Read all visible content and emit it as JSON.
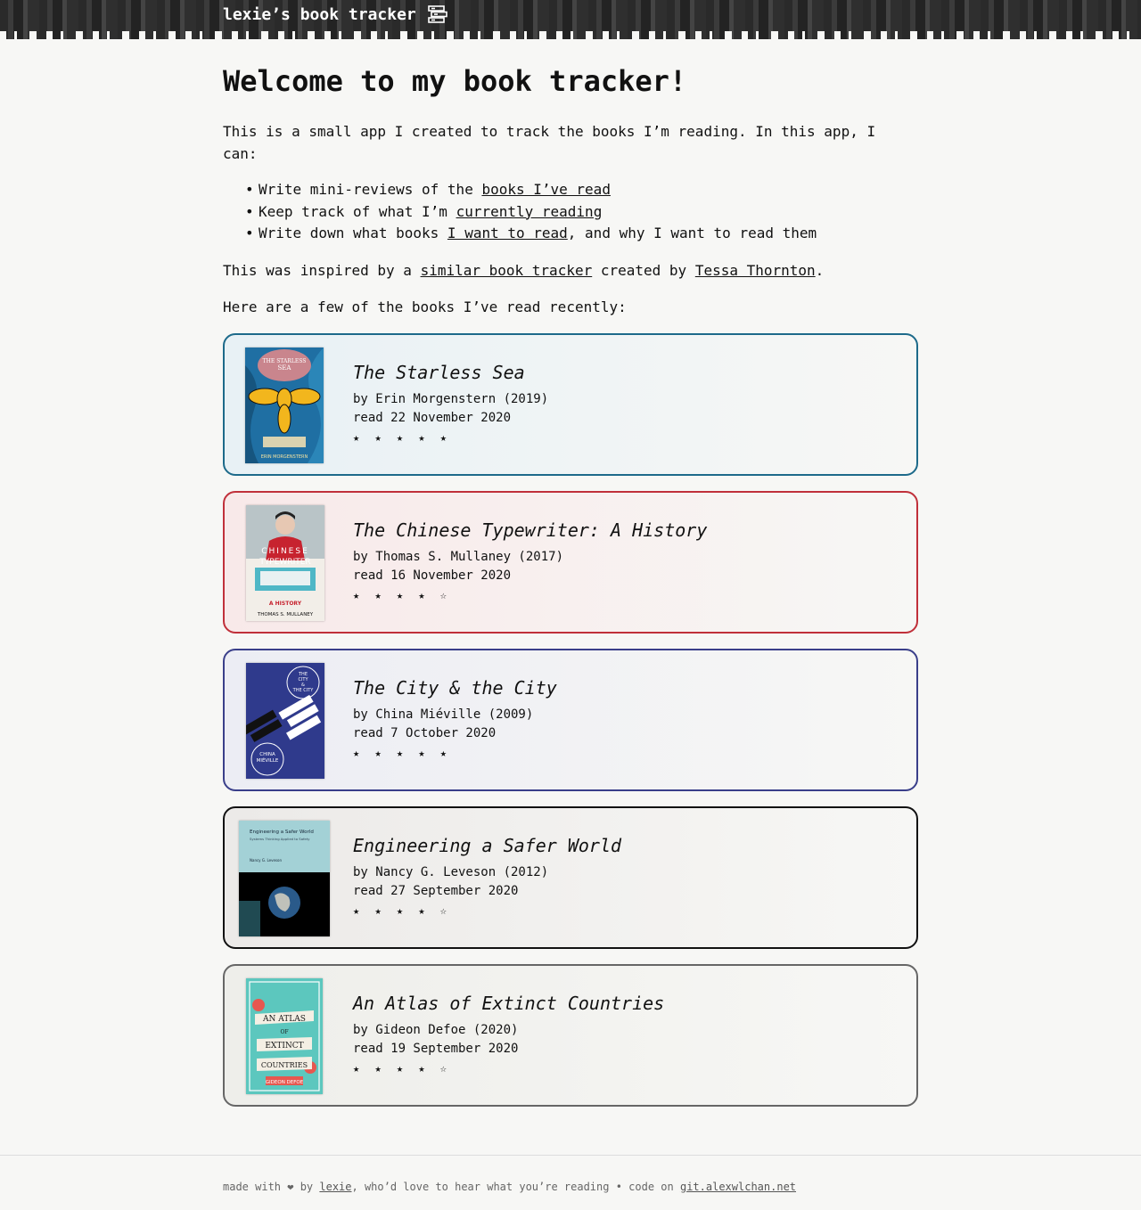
{
  "header": {
    "site_title": "lexie’s book tracker",
    "icon": "books-icon"
  },
  "main": {
    "heading": "Welcome to my book tracker!",
    "intro": "This is a small app I created to track the books I’m reading. In this app, I can:",
    "features": [
      {
        "before": "Write mini-reviews of the ",
        "link": "books I’ve read",
        "after": ""
      },
      {
        "before": "Keep track of what I’m ",
        "link": "currently reading",
        "after": ""
      },
      {
        "before": "Write down what books ",
        "link": "I want to read",
        "after": ", and why I want to read them"
      }
    ],
    "inspired": {
      "before": "This was inspired by a ",
      "link1": "similar book tracker",
      "middle": " created by ",
      "link2": "Tessa Thornton",
      "after": "."
    },
    "recent_intro": "Here are a few of the books I’ve read recently:"
  },
  "books": [
    {
      "title": "The Starless Sea",
      "author_line": "by Erin Morgenstern (2019)",
      "read_line": "read 22 November 2020",
      "rating": "★ ★ ★ ★ ★",
      "border_color": "#1d6a8a",
      "tint": "#e8f1f5",
      "cover": {
        "text_top": "THE STARLESS SEA",
        "text_bottom": "ERIN MORGENSTERN",
        "bg": "#1e6ea0"
      }
    },
    {
      "title": "The Chinese Typewriter: A History",
      "author_line": "by Thomas S. Mullaney (2017)",
      "read_line": "read 16 November 2020",
      "rating": "★ ★ ★ ★ ☆",
      "border_color": "#c0303a",
      "tint": "#f8e9e9",
      "cover": {
        "text_top": "THE CHINESE TYPEWRITER",
        "text_bottom": "A HISTORY",
        "author": "THOMAS S. MULLANEY",
        "bg": "#f0ece6"
      }
    },
    {
      "title": "The City & the City",
      "author_line": "by China Miéville (2009)",
      "read_line": "read 7 October 2020",
      "rating": "★ ★ ★ ★ ★",
      "border_color": "#3a3f8a",
      "tint": "#ecedf4",
      "cover": {
        "text_top": "THE CITY & THE CITY",
        "text_bottom": "CHINA MIÉVILLE",
        "bg": "#2f3a8c"
      }
    },
    {
      "title": "Engineering a Safer World",
      "author_line": "by Nancy G. Leveson (2012)",
      "read_line": "read 27 September 2020",
      "rating": "★ ★ ★ ★ ☆",
      "border_color": "#111111",
      "tint": "#eceae8",
      "cover": {
        "text_top": "Engineering a Safer World",
        "text_bottom": "Nancy G. Leveson",
        "bg": "#9fcfd4"
      }
    },
    {
      "title": "An Atlas of Extinct Countries",
      "author_line": "by Gideon Defoe (2020)",
      "read_line": "read 19 September 2020",
      "rating": "★ ★ ★ ★ ☆",
      "border_color": "#666666",
      "tint": "#eeeeea",
      "cover": {
        "text_top": "AN ATLAS OF EXTINCT COUNTRIES",
        "text_bottom": "GIDEON DEFOE",
        "bg": "#5cc7be"
      }
    }
  ],
  "footer": {
    "before": "made with ❤ by ",
    "link1": "lexie",
    "middle": ", who’d love to hear what you’re reading • code on ",
    "link2": "git.alexwlchan.net"
  }
}
